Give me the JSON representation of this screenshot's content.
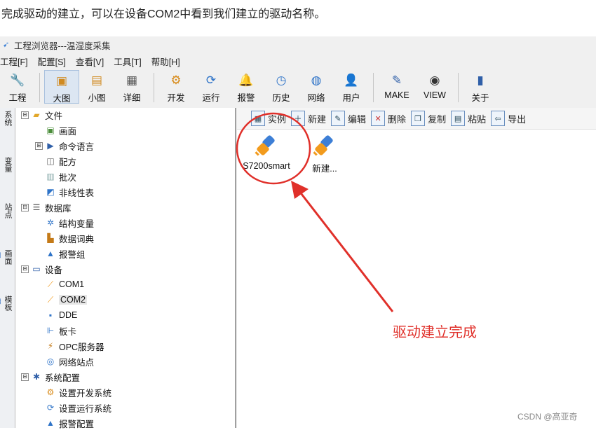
{
  "caption": "完成驱动的建立，可以在设备COM2中看到我们建立的驱动名称。",
  "window": {
    "title": "工程浏览器---温湿度采集",
    "title_icon": "app-arrow-icon"
  },
  "menu": [
    "工程[F]",
    "配置[S]",
    "查看[V]",
    "工具[T]",
    "帮助[H]"
  ],
  "toolbar": [
    {
      "label": "工程",
      "icon": "wrench-icon",
      "glyph": "🔧"
    },
    {
      "label": "大图",
      "icon": "large-icons-icon",
      "glyph": "▣",
      "active": true
    },
    {
      "label": "小图",
      "icon": "small-icons-icon",
      "glyph": "▤"
    },
    {
      "label": "详细",
      "icon": "details-icon",
      "glyph": "▦"
    },
    {
      "label": "开发",
      "icon": "develop-gear-icon",
      "glyph": "⚙"
    },
    {
      "label": "运行",
      "icon": "run-icon",
      "glyph": "⟳"
    },
    {
      "label": "报警",
      "icon": "alarm-bell-icon",
      "glyph": "🔔"
    },
    {
      "label": "历史",
      "icon": "history-clock-icon",
      "glyph": "◷"
    },
    {
      "label": "网络",
      "icon": "network-globe-icon",
      "glyph": "◍"
    },
    {
      "label": "用户",
      "icon": "user-icon",
      "glyph": "👤"
    },
    {
      "label": "MAKE",
      "icon": "make-edit-icon",
      "glyph": "✎"
    },
    {
      "label": "VIEW",
      "icon": "view-eye-icon",
      "glyph": "◉"
    },
    {
      "label": "关于",
      "icon": "about-book-icon",
      "glyph": "▮"
    }
  ],
  "side_tabs": [
    "系统",
    "变量",
    "站点",
    "画面",
    "模板"
  ],
  "tree": {
    "file": {
      "label": "文件",
      "expander": "⊟",
      "children": [
        "画面",
        "命令语言",
        "配方",
        "批次",
        "非线性表"
      ]
    },
    "database": {
      "label": "数据库",
      "expander": "⊟",
      "children": [
        "结构变量",
        "数据词典",
        "报警组"
      ]
    },
    "device": {
      "label": "设备",
      "expander": "⊟",
      "children": [
        "COM1",
        "COM2",
        "DDE",
        "板卡",
        "OPC服务器",
        "网络站点"
      ]
    },
    "system": {
      "label": "系统配置",
      "expander": "⊟",
      "children": [
        "设置开发系统",
        "设置运行系统",
        "报警配置"
      ]
    },
    "cmd_expander": "⊞"
  },
  "right_toolbar": [
    "实例",
    "新建",
    "编辑",
    "删除",
    "复制",
    "粘贴",
    "导出"
  ],
  "devices": [
    "S7200smart",
    "新建..."
  ],
  "annotation": "驱动建立完成",
  "watermark": "CSDN @高亚奇",
  "colors": {
    "annotation_red": "#e0302a",
    "plug_orange": "#f29b1d",
    "plug_blue": "#3d7fd6"
  }
}
